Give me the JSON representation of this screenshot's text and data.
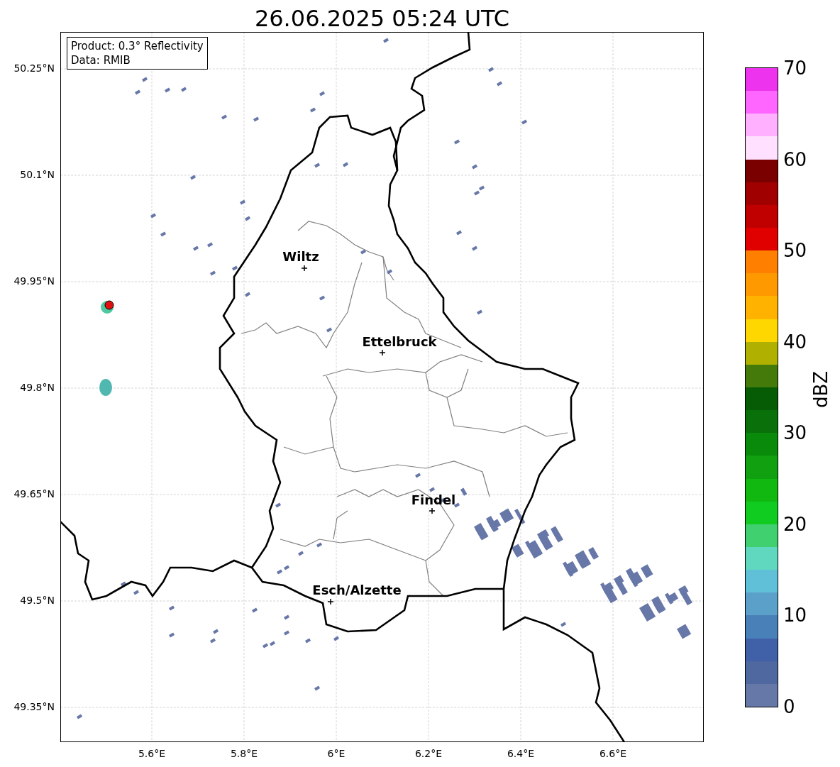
{
  "title": "26.06.2025 05:24 UTC",
  "info_box": {
    "product": "Product: 0.3° Reflectivity",
    "data": "Data: RMIB"
  },
  "cities": [
    {
      "name": "Wiltz"
    },
    {
      "name": "Ettelbruck"
    },
    {
      "name": "Findel"
    },
    {
      "name": "Esch/Alzette"
    }
  ],
  "lat_ticks": [
    "50.25°N",
    "50.1°N",
    "49.95°N",
    "49.8°N",
    "49.65°N",
    "49.5°N",
    "49.35°N"
  ],
  "lon_ticks": [
    "5.6°E",
    "5.8°E",
    "6°E",
    "6.2°E",
    "6.4°E",
    "6.6°E"
  ],
  "colorbar": {
    "label": "dBZ",
    "ticks": [
      "70",
      "60",
      "50",
      "40",
      "30",
      "20",
      "10",
      "0"
    ],
    "segments": [
      {
        "color": "#ee33ee"
      },
      {
        "color": "#ff66ff"
      },
      {
        "color": "#ffb0ff"
      },
      {
        "color": "#ffe0ff"
      },
      {
        "color": "#7a0000"
      },
      {
        "color": "#a00000"
      },
      {
        "color": "#c00000"
      },
      {
        "color": "#e00000"
      },
      {
        "color": "#ff7f00"
      },
      {
        "color": "#ff9900"
      },
      {
        "color": "#ffb300"
      },
      {
        "color": "#ffd700"
      },
      {
        "color": "#b0b000"
      },
      {
        "color": "#447a0a"
      },
      {
        "color": "#055c05"
      },
      {
        "color": "#0a700a"
      },
      {
        "color": "#0a8a0a"
      },
      {
        "color": "#10a010"
      },
      {
        "color": "#10b810"
      },
      {
        "color": "#10cc20"
      },
      {
        "color": "#40d070"
      },
      {
        "color": "#60d8c0"
      },
      {
        "color": "#60c0d8"
      },
      {
        "color": "#5aa0c8"
      },
      {
        "color": "#4a80b8"
      },
      {
        "color": "#4060a8"
      },
      {
        "color": "#5068a0"
      },
      {
        "color": "#6678a8"
      }
    ]
  }
}
